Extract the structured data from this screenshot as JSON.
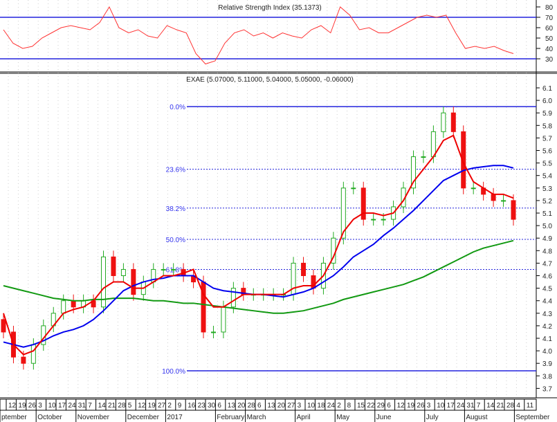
{
  "chart_data": [
    {
      "type": "line",
      "title": "Relative Strength Index (35.1373)",
      "ylim": [
        20,
        85
      ],
      "yticks": [
        30,
        40,
        50,
        60,
        70,
        80
      ],
      "levels": [
        70,
        30
      ],
      "values": [
        58,
        45,
        40,
        42,
        50,
        55,
        60,
        62,
        60,
        58,
        65,
        80,
        60,
        55,
        58,
        52,
        50,
        62,
        58,
        55,
        35,
        25,
        28,
        45,
        55,
        58,
        52,
        55,
        50,
        55,
        52,
        50,
        58,
        62,
        55,
        80,
        72,
        58,
        60,
        55,
        55,
        60,
        65,
        70,
        72,
        70,
        72,
        55,
        40,
        42,
        40,
        42,
        38,
        35
      ]
    },
    {
      "type": "candlestick",
      "title": "EXAE (5.07000, 5.11000, 5.04000, 5.05000, -0.06000)",
      "ylim": [
        3.65,
        6.15
      ],
      "yticks": [
        "3.7",
        "3.8",
        "3.9",
        "4.0",
        "4.1",
        "4.2",
        "4.3",
        "4.4",
        "4.5",
        "4.6",
        "4.7",
        "4.8",
        "4.9",
        "5.0",
        "5.1",
        "5.2",
        "5.3",
        "5.4",
        "5.5",
        "5.6",
        "5.7",
        "5.8",
        "5.9",
        "6.0",
        "6.1"
      ],
      "close": [
        4.15,
        3.95,
        3.9,
        4.05,
        4.2,
        4.3,
        4.4,
        4.35,
        4.4,
        4.35,
        4.75,
        4.6,
        4.65,
        4.45,
        4.55,
        4.65,
        4.65,
        4.65,
        4.6,
        4.55,
        4.15,
        4.15,
        4.35,
        4.5,
        4.45,
        4.45,
        4.45,
        4.45,
        4.45,
        4.7,
        4.6,
        4.5,
        4.7,
        4.9,
        5.3,
        5.3,
        5.05,
        5.05,
        5.05,
        5.15,
        5.3,
        5.55,
        5.55,
        5.75,
        5.9,
        5.75,
        5.3,
        5.3,
        5.25,
        5.2,
        5.2,
        5.05
      ],
      "ma_short": [
        4.3,
        4.05,
        3.97,
        4.0,
        4.1,
        4.2,
        4.3,
        4.33,
        4.35,
        4.4,
        4.5,
        4.55,
        4.55,
        4.5,
        4.5,
        4.55,
        4.6,
        4.6,
        4.62,
        4.65,
        4.45,
        4.35,
        4.35,
        4.4,
        4.45,
        4.45,
        4.45,
        4.45,
        4.45,
        4.5,
        4.52,
        4.52,
        4.6,
        4.75,
        4.95,
        5.05,
        5.1,
        5.1,
        5.08,
        5.1,
        5.2,
        5.35,
        5.45,
        5.55,
        5.68,
        5.72,
        5.5,
        5.35,
        5.3,
        5.25,
        5.25,
        5.22
      ],
      "ma_mid": [
        4.07,
        4.05,
        4.03,
        4.05,
        4.08,
        4.12,
        4.15,
        4.17,
        4.2,
        4.25,
        4.32,
        4.4,
        4.48,
        4.52,
        4.55,
        4.57,
        4.58,
        4.6,
        4.6,
        4.6,
        4.55,
        4.5,
        4.48,
        4.47,
        4.46,
        4.45,
        4.45,
        4.44,
        4.43,
        4.45,
        4.47,
        4.5,
        4.55,
        4.6,
        4.67,
        4.75,
        4.8,
        4.85,
        4.92,
        4.98,
        5.05,
        5.12,
        5.2,
        5.28,
        5.36,
        5.4,
        5.44,
        5.46,
        5.47,
        5.48,
        5.48,
        5.46
      ],
      "ma_long": [
        4.52,
        4.5,
        4.48,
        4.46,
        4.44,
        4.42,
        4.41,
        4.4,
        4.4,
        4.41,
        4.41,
        4.42,
        4.42,
        4.42,
        4.41,
        4.4,
        4.4,
        4.39,
        4.38,
        4.38,
        4.37,
        4.36,
        4.35,
        4.34,
        4.33,
        4.32,
        4.31,
        4.3,
        4.3,
        4.31,
        4.32,
        4.34,
        4.36,
        4.38,
        4.41,
        4.43,
        4.45,
        4.47,
        4.49,
        4.51,
        4.53,
        4.56,
        4.59,
        4.63,
        4.67,
        4.71,
        4.75,
        4.79,
        4.82,
        4.84,
        4.86,
        4.88
      ],
      "fibonacci": [
        {
          "label": "0.0%",
          "value": 5.95
        },
        {
          "label": "23.6%",
          "value": 5.45
        },
        {
          "label": "38.2%",
          "value": 5.14
        },
        {
          "label": "50.0%",
          "value": 4.89
        },
        {
          "label": "61.8%",
          "value": 4.65
        },
        {
          "label": "100.0%",
          "value": 3.84
        }
      ],
      "x_ticks": [
        "12",
        "19",
        "26",
        "3",
        "10",
        "17",
        "24",
        "31",
        "7",
        "14",
        "21",
        "28",
        "5",
        "12",
        "19",
        "27",
        "2",
        "9",
        "16",
        "23",
        "30",
        "6",
        "13",
        "20",
        "28",
        "6",
        "13",
        "20",
        "27",
        "3",
        "10",
        "18",
        "24",
        "2",
        "8",
        "15",
        "22",
        "29",
        "6",
        "12",
        "19",
        "26",
        "3",
        "10",
        "17",
        "24",
        "31",
        "7",
        "14",
        "21",
        "28",
        "4",
        "11"
      ],
      "months": [
        {
          "label": "ptember",
          "tick": -1
        },
        {
          "label": "October",
          "tick": 3
        },
        {
          "label": "November",
          "tick": 7
        },
        {
          "label": "December",
          "tick": 12
        },
        {
          "label": "2017",
          "tick": 16
        },
        {
          "label": "February",
          "tick": 21
        },
        {
          "label": "March",
          "tick": 24
        },
        {
          "label": "April",
          "tick": 29
        },
        {
          "label": "May",
          "tick": 33
        },
        {
          "label": "June",
          "tick": 37
        },
        {
          "label": "July",
          "tick": 42
        },
        {
          "label": "August",
          "tick": 46
        },
        {
          "label": "September",
          "tick": 51
        }
      ]
    }
  ],
  "colors": {
    "up": "#22aa22",
    "down": "#ee1111",
    "rsi": "#ff3333",
    "ma_short": "#ee0000",
    "ma_mid": "#0000ee",
    "ma_long": "#119911",
    "level": "#2222dd",
    "fib": "#2222dd"
  }
}
